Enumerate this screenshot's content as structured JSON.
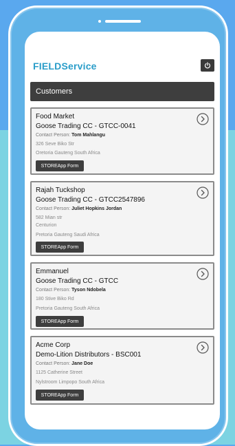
{
  "app": {
    "logo": "FIELDService"
  },
  "header": {
    "title": "Customers"
  },
  "customers": [
    {
      "name": "Food Market",
      "company": "Goose Trading CC - GTCC-0041",
      "contact_prefix": "Contact Person:",
      "contact_name": "Tom Mahlangu",
      "lines": [
        "326 Seve Biko Str",
        "Oretoria Gauteng South Africa"
      ],
      "button": "STOREApp Form"
    },
    {
      "name": "Rajah Tuckshop",
      "company": "Goose Trading CC - GTCC2547896",
      "contact_prefix": "Contact Person:",
      "contact_name": "Juliet Hopkins Jordan",
      "lines": [
        "582 Mian str",
        "Centurion",
        "Pretoria Gauteng Saudi Africa"
      ],
      "button": "STOREApp Form"
    },
    {
      "name": "Emmanuel",
      "company": "Goose Trading CC - GTCC",
      "contact_prefix": "Contact Person:",
      "contact_name": "Tyson Ndobela",
      "lines": [
        "180 Stive Biko Rd",
        "Pretoria Gauteng South Africa"
      ],
      "button": "STOREApp Form"
    },
    {
      "name": "Acme Corp",
      "company": "Demo-Lition Distributors - BSC001",
      "contact_prefix": "Contact Person:",
      "contact_name": "Jane Doe",
      "lines": [
        "1125 Catherine Street",
        "Nylstroom Limpopo South Africa"
      ],
      "button": "STOREApp Form"
    }
  ]
}
